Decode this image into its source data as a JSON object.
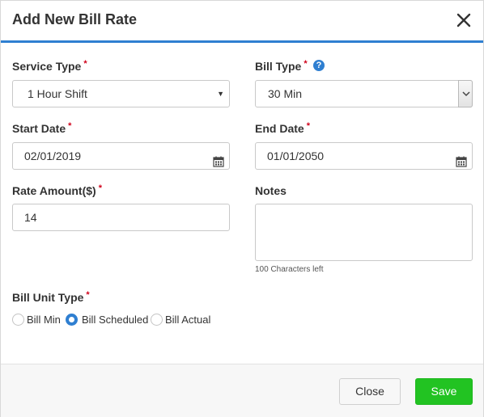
{
  "dialog": {
    "title": "Add New Bill Rate",
    "close_icon": "close-icon"
  },
  "form": {
    "required_mark": "*",
    "service_type": {
      "label": "Service Type",
      "value": "1 Hour Shift",
      "icon": "caret-down-icon"
    },
    "bill_type": {
      "label": "Bill Type",
      "value": "30 Min",
      "help_icon": "question-circle-icon",
      "help_glyph": "?",
      "icon": "chevron-down-icon"
    },
    "start_date": {
      "label": "Start Date",
      "value": "02/01/2019",
      "icon": "calendar-icon"
    },
    "end_date": {
      "label": "End Date",
      "value": "01/01/2050",
      "icon": "calendar-icon"
    },
    "rate_amount": {
      "label": "Rate Amount($)",
      "value": "14"
    },
    "notes": {
      "label": "Notes",
      "value": "",
      "chars_left": "100 Characters left"
    },
    "bill_unit_type": {
      "label": "Bill Unit Type",
      "options": [
        {
          "label": "Bill Min",
          "checked": false
        },
        {
          "label": "Bill Scheduled",
          "checked": true
        },
        {
          "label": "Bill Actual",
          "checked": false
        }
      ]
    }
  },
  "footer": {
    "close_label": "Close",
    "save_label": "Save"
  },
  "colors": {
    "accent": "#2f7fd1",
    "required": "#d0021b",
    "save": "#22c322"
  }
}
